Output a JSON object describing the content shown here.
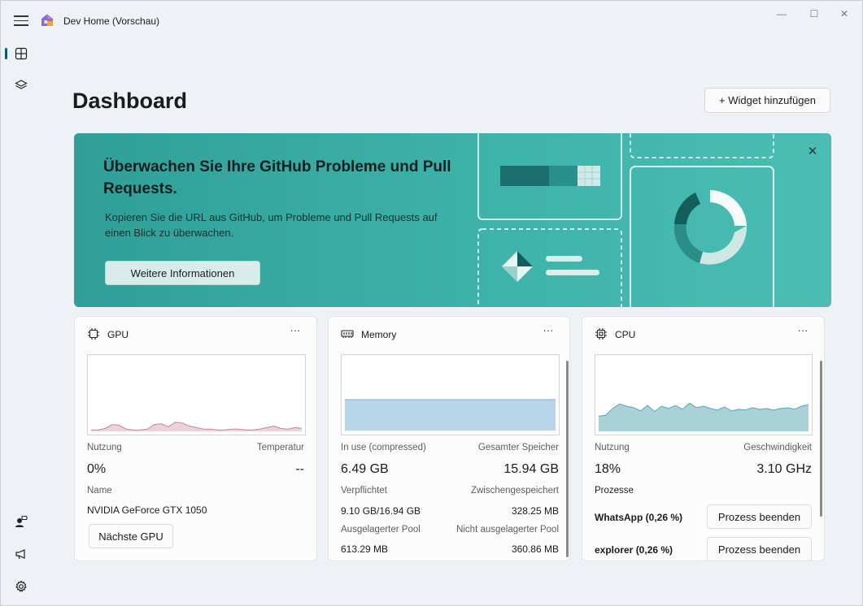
{
  "app": {
    "title": "Dev Home (Vorschau)",
    "accent": "#0b5a66"
  },
  "window_controls": {
    "minimize": "—",
    "maximize": "☐",
    "close": "✕"
  },
  "rail": {
    "items": [
      {
        "name": "dashboard-icon",
        "active": true
      },
      {
        "name": "layers-icon",
        "active": false
      }
    ],
    "bottom": [
      {
        "name": "account-icon"
      },
      {
        "name": "feedback-megaphone-icon"
      },
      {
        "name": "settings-gear-icon"
      }
    ]
  },
  "header": {
    "title": "Dashboard",
    "add_widget_label": "+ Widget hinzufügen"
  },
  "banner": {
    "title": "Überwachen Sie Ihre GitHub Probleme und Pull Requests.",
    "description": "Kopieren Sie die URL aus GitHub, um Probleme und Pull Requests auf einen Blick zu überwachen.",
    "button_label": "Weitere Informationen",
    "close_label": "✕",
    "color": "#3aaea6"
  },
  "widgets": {
    "more_label": "···",
    "gpu": {
      "title": "GPU",
      "usage_label": "Nutzung",
      "usage_value": "0%",
      "temp_label": "Temperatur",
      "temp_value": "--",
      "name_label": "Name",
      "name_value": "NVIDIA GeForce GTX 1050",
      "next_button": "Nächste GPU",
      "chart_color": "#c7849a",
      "chart_fill": "#ead3db",
      "chart_values": [
        2,
        2,
        4,
        9,
        8,
        3,
        2,
        2,
        3,
        9,
        10,
        6,
        12,
        11,
        7,
        5,
        3,
        3,
        2,
        2,
        3,
        3,
        2,
        2,
        3,
        5,
        7,
        4,
        3,
        5,
        4
      ]
    },
    "memory": {
      "title": "Memory",
      "inuse_label": "In use (compressed)",
      "inuse_value": "6.49 GB",
      "total_label": "Gesamter Speicher",
      "total_value": "15.94 GB",
      "committed_label": "Verpflichtet",
      "committed_value": "9.10 GB/16.94 GB",
      "cached_label": "Zwischengespeichert",
      "cached_value": "328.25 MB",
      "paged_label": "Ausgelagerter Pool",
      "paged_value": "613.29 MB",
      "nonpaged_label": "Nicht ausgelagerter Pool",
      "nonpaged_value": "360.86 MB",
      "chart_color": "#6fa6c9",
      "chart_fill": "#b7d4e8",
      "usage_fraction": 0.41
    },
    "cpu": {
      "title": "CPU",
      "usage_label": "Nutzung",
      "usage_value": "18%",
      "speed_label": "Geschwindigkeit",
      "speed_value": "3.10 GHz",
      "processes_label": "Prozesse",
      "processes": [
        {
          "name": "WhatsApp (0,26 %)",
          "action": "Prozess beenden"
        },
        {
          "name": "explorer (0,26 %)",
          "action": "Prozess beenden"
        }
      ],
      "chart_color": "#5aa6b3",
      "chart_fill": "#a8d1d8",
      "chart_values": [
        20,
        21,
        30,
        36,
        33,
        31,
        27,
        34,
        26,
        33,
        30,
        34,
        29,
        37,
        31,
        33,
        30,
        28,
        32,
        27,
        29,
        28,
        31,
        29,
        30,
        28,
        30,
        31,
        29,
        33,
        35
      ]
    }
  }
}
